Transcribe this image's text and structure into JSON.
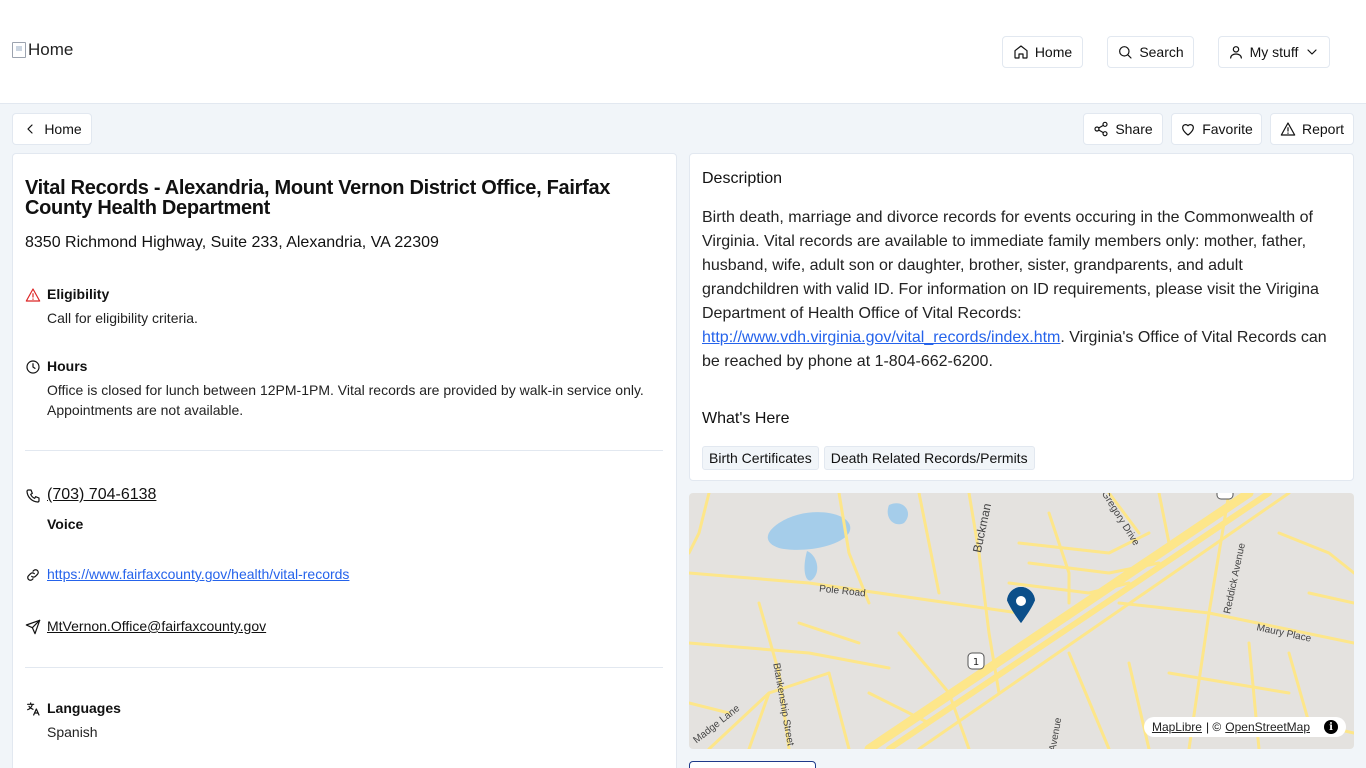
{
  "header": {
    "logo_alt": "Home",
    "nav": {
      "home": "Home",
      "search": "Search",
      "my_stuff": "My stuff"
    }
  },
  "toolbar": {
    "back": "Home",
    "share": "Share",
    "favorite": "Favorite",
    "report": "Report"
  },
  "listing": {
    "title": "Vital Records - Alexandria, Mount Vernon District Office, Fairfax County Health Department",
    "address": "8350 Richmond Highway, Suite 233, Alexandria, VA 22309",
    "eligibility": {
      "label": "Eligibility",
      "text": "Call for eligibility criteria."
    },
    "hours": {
      "label": "Hours",
      "text": "Office is closed for lunch between 12PM-1PM. Vital records are provided by walk-in service only. Appointments are not available."
    },
    "phone": {
      "number": "(703) 704-6138",
      "type": "Voice"
    },
    "website": "https://www.fairfaxcounty.gov/health/vital-records",
    "email": "MtVernon.Office@fairfaxcounty.gov",
    "languages": {
      "label": "Languages",
      "value": "Spanish"
    }
  },
  "description": {
    "heading": "Description",
    "text_before": "Birth death, marriage and divorce records for events occuring in the Commonwealth of Virginia. Vital records are available to immediate family members only: mother, father, husband, wife, adult son or daughter, brother, sister, grandparents, and adult grandchildren with valid ID. For information on ID requirements, please visit the Virigina Department of Health Office of Vital Records: ",
    "link": "http://www.vdh.virginia.gov/vital_records/index.htm",
    "text_after": ". Virginia's Office of Vital Records can be reached by phone at 1-804-662-6200."
  },
  "whats_here": {
    "heading": "What's Here",
    "tags": [
      "Birth Certificates",
      "Death Related Records/Permits"
    ]
  },
  "map": {
    "labels": {
      "buckman": "Buckman",
      "gregory": "Gregory Drive",
      "pole": "Pole Road",
      "reddick": "Reddick Avenue",
      "maury": "Maury Place",
      "blankenship": "Blankenship Street",
      "madge": "Madge Lane",
      "avenue": "Avenue",
      "route": "1"
    },
    "attribution": {
      "maplibre": "MapLibre",
      "separator": "| ©",
      "osm": "OpenStreetMap",
      "info": "i"
    },
    "colors": {
      "land": "#e4e2df",
      "water": "#a5cdea",
      "road": "#fde68a",
      "pin": "#0b4f8a"
    }
  }
}
